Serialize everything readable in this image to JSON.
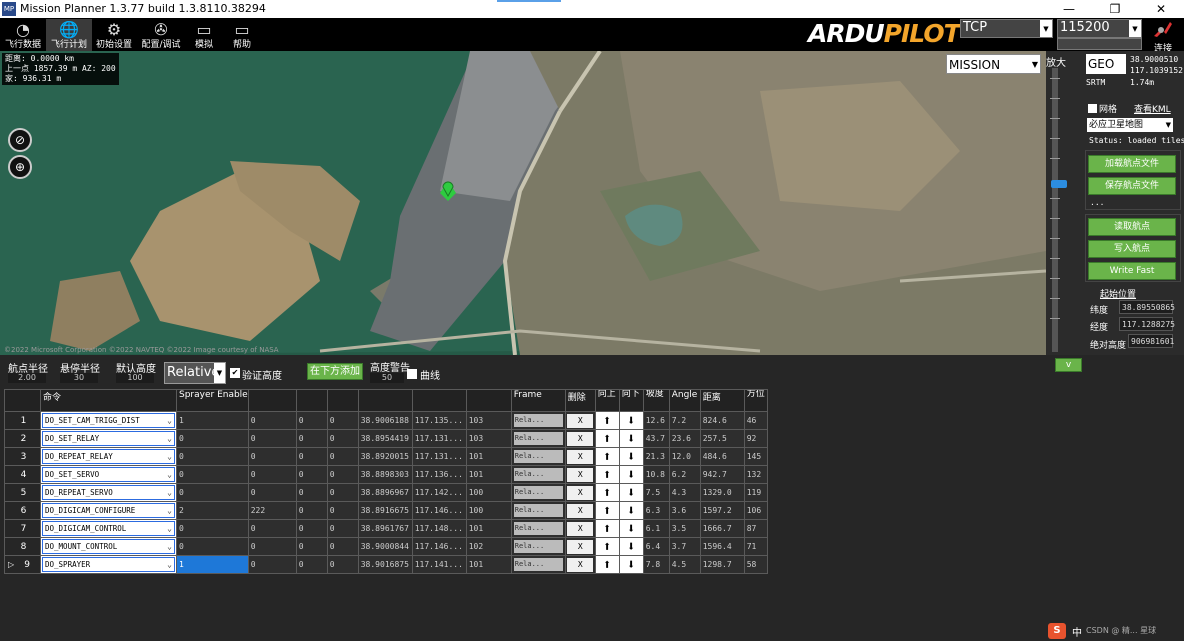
{
  "window": {
    "title": "Mission Planner 1.3.77 build 1.3.8110.38294",
    "app_icon": "MP",
    "minimize": "—",
    "maximize": "❐",
    "close": "✕"
  },
  "menu": [
    {
      "label": "飞行数据",
      "icon": "gauge-icon"
    },
    {
      "label": "飞行计划",
      "icon": "globe-icon"
    },
    {
      "label": "初始设置",
      "icon": "gear-icon"
    },
    {
      "label": "配置/调试",
      "icon": "wrench-icon"
    },
    {
      "label": "模拟",
      "icon": "monitor-icon"
    },
    {
      "label": "帮助",
      "icon": "help-monitor-icon"
    }
  ],
  "logo": {
    "part1": "ARDU",
    "part2": "PILOT"
  },
  "connection": {
    "port": "TCP",
    "baud": "115200",
    "connect_label": "连接"
  },
  "map": {
    "distance_info": [
      "距离: 0.0000 km",
      "上一点  1857.39 m AZ: 200",
      "家:  936.31 m"
    ],
    "mode_combo": "MISSION",
    "copyright": "©2022 Microsoft Corporation ©2022 NAVTEQ ©2022 Image courtesy of NASA"
  },
  "right_panel": {
    "zoom_label": "放大",
    "coord_system": "GEO",
    "lat": "38.9000510",
    "lng": "117.1039152",
    "srtm_label": "SRTM",
    "srtm_value": "1.74m",
    "grid_label": "网格",
    "view_kml": "查看KML",
    "map_provider": "必应卫星地图",
    "status": "Status: loaded tiles",
    "load_wp_file": "加载航点文件",
    "save_wp_file": "保存航点文件",
    "ellipsis": "...",
    "read_wp": "读取航点",
    "write_wp": "写入航点",
    "write_fast": "Write Fast",
    "home_title": "起始位置",
    "home_lat_label": "纬度",
    "home_lat": "38.89550865",
    "home_lng_label": "经度",
    "home_lng": "117.1288275",
    "home_alt_label": "绝对高度",
    "home_alt": "906981601",
    "collapse_btn": "v"
  },
  "params": {
    "wp_radius_label": "航点半径",
    "wp_radius": "2.00",
    "loiter_radius_label": "悬停半径",
    "loiter_radius": "30",
    "default_alt_label": "默认高度",
    "default_alt": "100",
    "alt_frame": "Relative",
    "verify_height_label": "验证高度",
    "add_below": "在下方添加",
    "alt_warn_label": "高度警告",
    "alt_warn": "50",
    "spline_label": "曲线"
  },
  "grid": {
    "headers": [
      "命令",
      "Sprayer Enable",
      "",
      "",
      "",
      "",
      "",
      "",
      "Frame",
      "删除",
      "向上",
      "向下",
      "坡度",
      "Angle",
      "距离",
      "方位"
    ],
    "rows": [
      {
        "n": "1",
        "cmd": "DO_SET_CAM_TRIGG_DIST",
        "p1": "1",
        "p2": "0",
        "p3": "0",
        "p4": "0",
        "lat": "38.9006188",
        "lng": "117.135...",
        "alt": "103",
        "frame": "Rela...",
        "grad": "12.6",
        "angle": "7.2",
        "dist": "824.6",
        "az": "46"
      },
      {
        "n": "2",
        "cmd": "DO_SET_RELAY",
        "p1": "0",
        "p2": "0",
        "p3": "0",
        "p4": "0",
        "lat": "38.8954419",
        "lng": "117.131...",
        "alt": "103",
        "frame": "Rela...",
        "grad": "43.7",
        "angle": "23.6",
        "dist": "257.5",
        "az": "92"
      },
      {
        "n": "3",
        "cmd": "DO_REPEAT_RELAY",
        "p1": "0",
        "p2": "0",
        "p3": "0",
        "p4": "0",
        "lat": "38.8920015",
        "lng": "117.131...",
        "alt": "101",
        "frame": "Rela...",
        "grad": "21.3",
        "angle": "12.0",
        "dist": "484.6",
        "az": "145"
      },
      {
        "n": "4",
        "cmd": "DO_SET_SERVO",
        "p1": "0",
        "p2": "0",
        "p3": "0",
        "p4": "0",
        "lat": "38.8898303",
        "lng": "117.136...",
        "alt": "101",
        "frame": "Rela...",
        "grad": "10.8",
        "angle": "6.2",
        "dist": "942.7",
        "az": "132"
      },
      {
        "n": "5",
        "cmd": "DO_REPEAT_SERVO",
        "p1": "0",
        "p2": "0",
        "p3": "0",
        "p4": "0",
        "lat": "38.8896967",
        "lng": "117.142...",
        "alt": "100",
        "frame": "Rela...",
        "grad": "7.5",
        "angle": "4.3",
        "dist": "1329.0",
        "az": "119"
      },
      {
        "n": "6",
        "cmd": "DO_DIGICAM_CONFIGURE",
        "p1": "2",
        "p2": "222",
        "p3": "0",
        "p4": "0",
        "lat": "38.8916675",
        "lng": "117.146...",
        "alt": "100",
        "frame": "Rela...",
        "grad": "6.3",
        "angle": "3.6",
        "dist": "1597.2",
        "az": "106"
      },
      {
        "n": "7",
        "cmd": "DO_DIGICAM_CONTROL",
        "p1": "0",
        "p2": "0",
        "p3": "0",
        "p4": "0",
        "lat": "38.8961767",
        "lng": "117.148...",
        "alt": "101",
        "frame": "Rela...",
        "grad": "6.1",
        "angle": "3.5",
        "dist": "1666.7",
        "az": "87"
      },
      {
        "n": "8",
        "cmd": "DO_MOUNT_CONTROL",
        "p1": "0",
        "p2": "0",
        "p3": "0",
        "p4": "0",
        "lat": "38.9000844",
        "lng": "117.146...",
        "alt": "102",
        "frame": "Rela...",
        "grad": "6.4",
        "angle": "3.7",
        "dist": "1596.4",
        "az": "71"
      },
      {
        "n": "9",
        "cmd": "DO_SPRAYER",
        "p1": "1",
        "p2": "0",
        "p3": "0",
        "p4": "0",
        "lat": "38.9016875",
        "lng": "117.141...",
        "alt": "101",
        "frame": "Rela...",
        "grad": "7.8",
        "angle": "4.5",
        "dist": "1298.7",
        "az": "58"
      }
    ],
    "delete_label": "X"
  },
  "ime": {
    "logo": "S",
    "lang": "中",
    "watermark": "CSDN @ 精... 星球"
  }
}
